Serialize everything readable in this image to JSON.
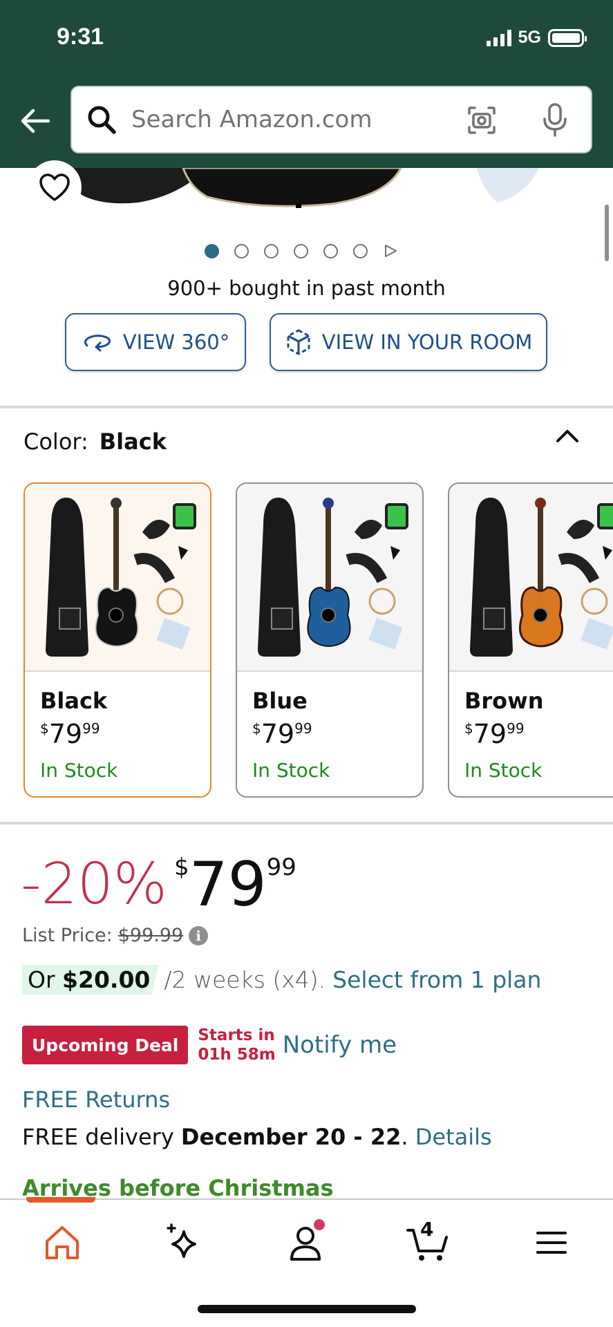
{
  "status_bar": {
    "time": "9:31",
    "network": "5G"
  },
  "search": {
    "placeholder": "Search Amazon.com"
  },
  "gallery": {
    "dot_count": 6,
    "active_index": 0
  },
  "social_proof": "900+ bought in past month",
  "view_buttons": {
    "view_360": "VIEW 360°",
    "view_room": "VIEW IN YOUR ROOM"
  },
  "color": {
    "label": "Color:",
    "selected": "Black",
    "options": [
      {
        "name": "Black",
        "price_symbol": "$",
        "price_whole": "79",
        "price_fraction": "99",
        "stock": "In Stock",
        "body_color": "#141414"
      },
      {
        "name": "Blue",
        "price_symbol": "$",
        "price_whole": "79",
        "price_fraction": "99",
        "stock": "In Stock",
        "body_color": "#1f5f9e"
      },
      {
        "name": "Brown",
        "price_symbol": "$",
        "price_whole": "79",
        "price_fraction": "99",
        "stock": "In Stock",
        "body_color": "#d9781e"
      }
    ]
  },
  "pricing": {
    "discount": "-20%",
    "price_symbol": "$",
    "price_whole": "79",
    "price_fraction": "99",
    "list_price_label": "List Price:",
    "list_price": "$99.99",
    "installment_prefix": "Or",
    "installment_amount": "$20.00",
    "installment_terms": "/2 weeks (x4).",
    "installment_link": "Select from 1 plan"
  },
  "deal": {
    "badge": "Upcoming Deal",
    "starts_label": "Starts in",
    "starts_time": "01h 58m",
    "notify": "Notify me"
  },
  "shipping": {
    "returns": "FREE Returns",
    "delivery_prefix": "FREE delivery",
    "delivery_dates": "December 20 - 22",
    "delivery_suffix": ".",
    "details_link": "Details",
    "arrives": "Arrives before Christmas"
  },
  "bottom_nav": {
    "cart_count": "4"
  },
  "colors": {
    "header_bg": "#1d4a3a",
    "link": "#2e6e84",
    "deal_red": "#c7203f",
    "stock_green": "#1f8a1f",
    "selected_border": "#e3892c"
  }
}
